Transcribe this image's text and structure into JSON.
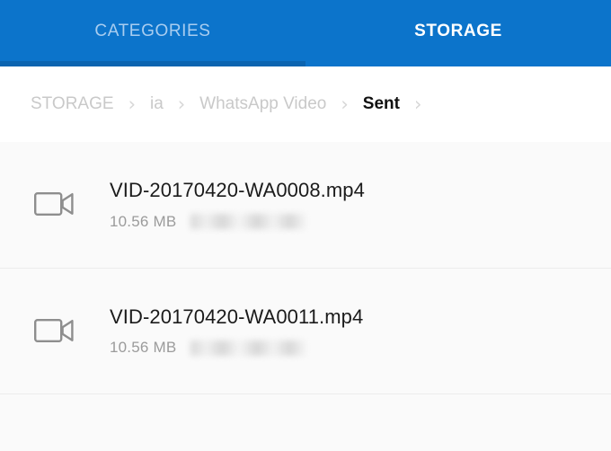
{
  "theme": {
    "header_blue": "#0c74cb",
    "indicator_blue": "#0b64b0",
    "inactive_tab_text": "#a8cdf0",
    "active_tab_text": "#ffffff",
    "list_background": "#fafafa",
    "divider": "#ececec",
    "filename_color": "#1b1b1b",
    "meta_color": "#9b9b9b",
    "crumb_inactive_color": "#c9c9c9",
    "crumb_active_color": "#111111"
  },
  "tabs": [
    {
      "label": "CATEGORIES",
      "active": false
    },
    {
      "label": "STORAGE",
      "active": true
    }
  ],
  "breadcrumb": {
    "separator": "›",
    "items": [
      {
        "label": "STORAGE",
        "current": false
      },
      {
        "label": "ia",
        "current": false
      },
      {
        "label": "WhatsApp Video",
        "current": false
      },
      {
        "label": "Sent",
        "current": true
      }
    ],
    "trailing_separator": "›"
  },
  "files": [
    {
      "icon": "video-camera-icon",
      "name": "VID-20170420-WA0008.mp4",
      "size": "10.56 MB",
      "date_redacted": true
    },
    {
      "icon": "video-camera-icon",
      "name": "VID-20170420-WA0011.mp4",
      "size": "10.56 MB",
      "date_redacted": true
    }
  ]
}
